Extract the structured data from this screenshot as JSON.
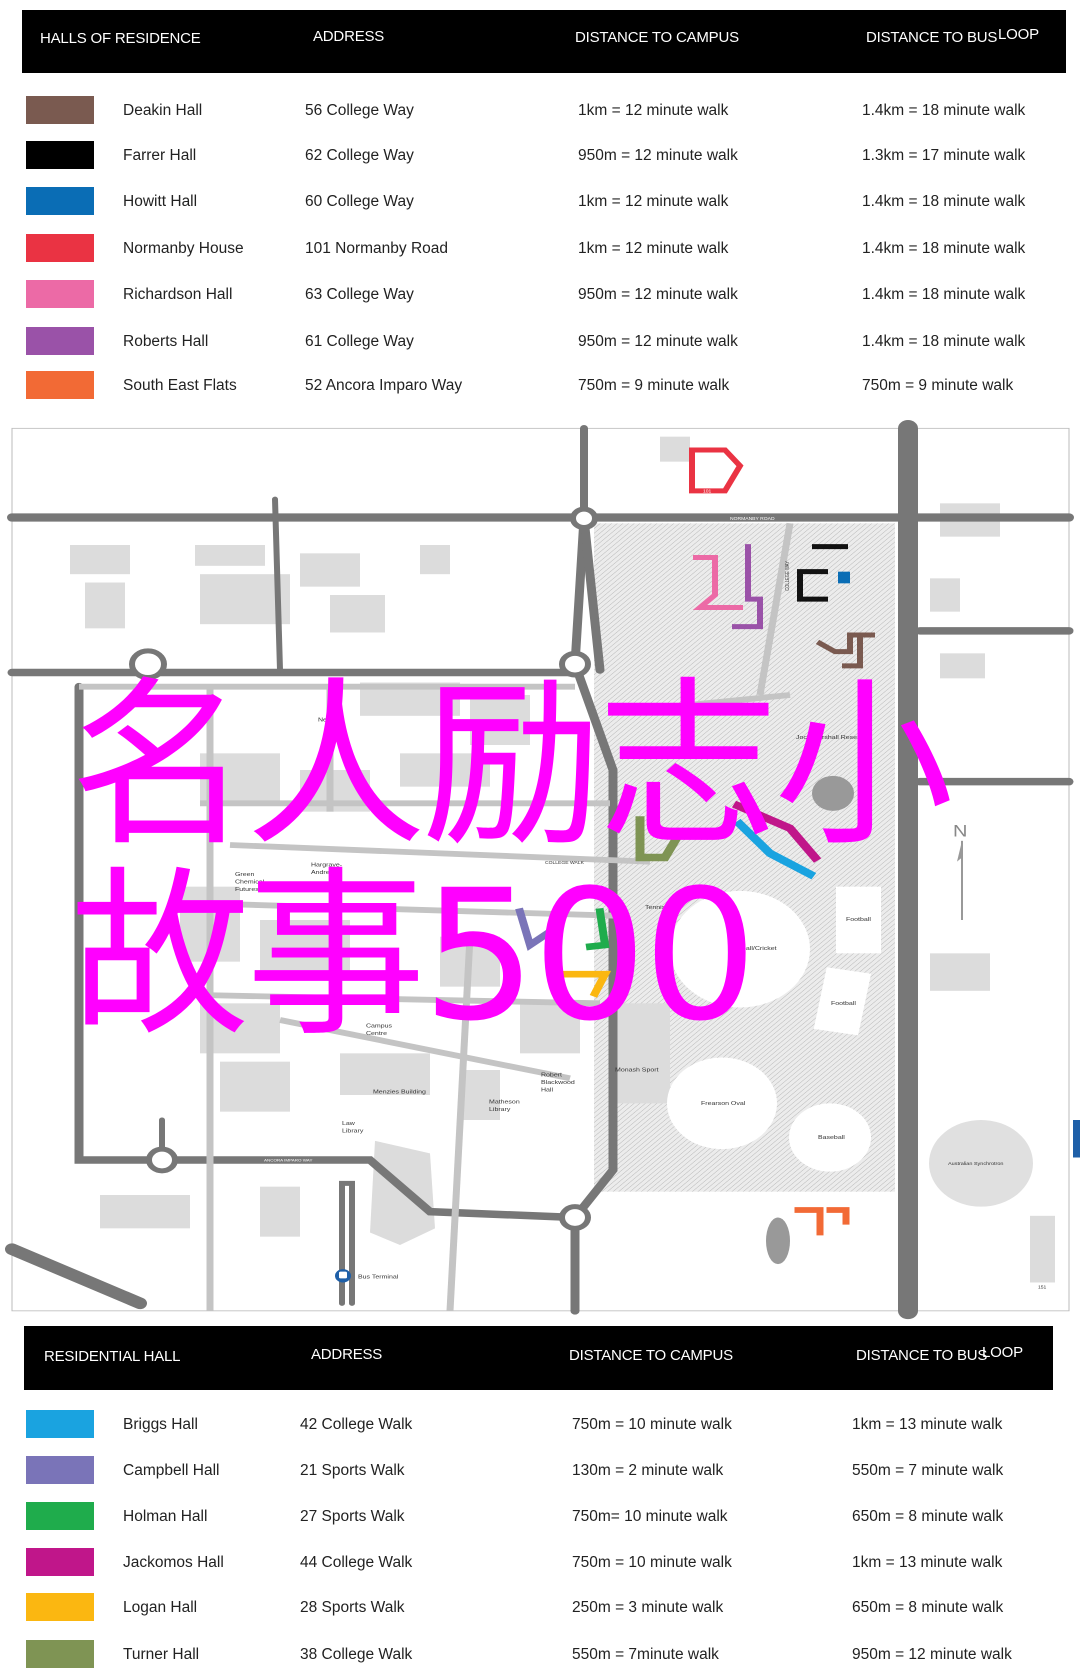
{
  "table1": {
    "headers": {
      "name": "HALLS OF RESIDENCE",
      "address": "ADDRESS",
      "campus": "DISTANCE TO CAMPUS",
      "bus": "DISTANCE TO BUS",
      "bus2": "LOOP"
    },
    "rows": [
      {
        "name": "Deakin Hall",
        "address": "56 College Way",
        "campus": "1km = 12 minute walk",
        "bus": "1.4km = 18 minute walk",
        "color": "#7a5a50"
      },
      {
        "name": "Farrer Hall",
        "address": "62 College Way",
        "campus": "950m = 12 minute walk",
        "bus": "1.3km = 17 minute walk",
        "color": "#000000"
      },
      {
        "name": "Howitt Hall",
        "address": "60 College Way",
        "campus": "1km = 12 minute walk",
        "bus": "1.4km = 18 minute walk",
        "color": "#0a6db5"
      },
      {
        "name": "Normanby House",
        "address": "101 Normanby Road",
        "campus": "1km = 12 minute walk",
        "bus": "1.4km = 18 minute walk",
        "color": "#ea3343"
      },
      {
        "name": "Richardson Hall",
        "address": "63 College Way",
        "campus": "950m = 12 minute walk",
        "bus": "1.4km = 18 minute walk",
        "color": "#ec6aa6"
      },
      {
        "name": "Roberts Hall",
        "address": "61 College Way",
        "campus": "950m = 12 minute walk",
        "bus": "1.4km = 18 minute walk",
        "color": "#9a52a8"
      },
      {
        "name": "South East Flats",
        "address": "52 Ancora Imparo Way",
        "campus": "750m = 9 minute walk",
        "bus": "750m = 9 minute walk",
        "color": "#f26a35"
      }
    ]
  },
  "map": {
    "labels": {
      "normanby_road": "NORMANBY ROAD",
      "college_walk": "COLLEGE WALK",
      "college_way": "COLLEGE WAY",
      "ancora": "ANCORA IMPARO WAY",
      "jock": "Jock Marshall Reser",
      "football1": "Football",
      "football2": "Football",
      "football_cricket": "Football/Cricket",
      "tennis": "Tennis",
      "monash_sport": "Monash Sport",
      "frearson": "Frearson Oval",
      "baseball": "Baseball",
      "synchrotron": "Australian Synchrotron",
      "rbh1": "Robert",
      "rbh2": "Blackwood",
      "rbh3": "Hall",
      "math1": "Matheson",
      "math2": "Library",
      "menzies": "Menzies Building",
      "law1": "Law",
      "law2": "Library",
      "cc1": "Campus",
      "cc2": "Centre",
      "gcf1": "Green",
      "gcf2": "Chemical",
      "gcf3": "Futures",
      "ha1": "Hargrave-",
      "ha2": "Andrew",
      "new": "New",
      "bus_terminal": "Bus Terminal",
      "north": "N",
      "num151": "151",
      "num101": "101"
    },
    "watermark_line1": "名人励志小",
    "watermark_line2": "故事500"
  },
  "table2": {
    "headers": {
      "name": "RESIDENTIAL HALL",
      "address": "ADDRESS",
      "campus": "DISTANCE TO CAMPUS",
      "bus": "DISTANCE TO BUS",
      "bus2": "LOOP"
    },
    "rows": [
      {
        "name": "Briggs Hall",
        "address": "42 College Walk",
        "campus": "750m = 10 minute walk",
        "bus": "1km = 13 minute walk",
        "color": "#1aa3e0"
      },
      {
        "name": "Campbell Hall",
        "address": "21 Sports Walk",
        "campus": "130m = 2 minute walk",
        "bus": "550m = 7 minute walk",
        "color": "#7a74b8"
      },
      {
        "name": "Holman Hall",
        "address": "27 Sports Walk",
        "campus": "750m= 10 minute walk",
        "bus": "650m = 8 minute walk",
        "color": "#1fac4c"
      },
      {
        "name": "Jackomos Hall",
        "address": "44 College Walk",
        "campus": "750m = 10 minute walk",
        "bus": "1km = 13 minute walk",
        "color": "#c0168a"
      },
      {
        "name": "Logan Hall",
        "address": "28 Sports Walk",
        "campus": "250m = 3 minute walk",
        "bus": "650m = 8 minute walk",
        "color": "#fbb711"
      },
      {
        "name": "Turner Hall",
        "address": "38 College Walk",
        "campus": "550m = 7minute walk",
        "bus": "950m = 12 minute walk",
        "color": "#7f9454"
      }
    ]
  }
}
